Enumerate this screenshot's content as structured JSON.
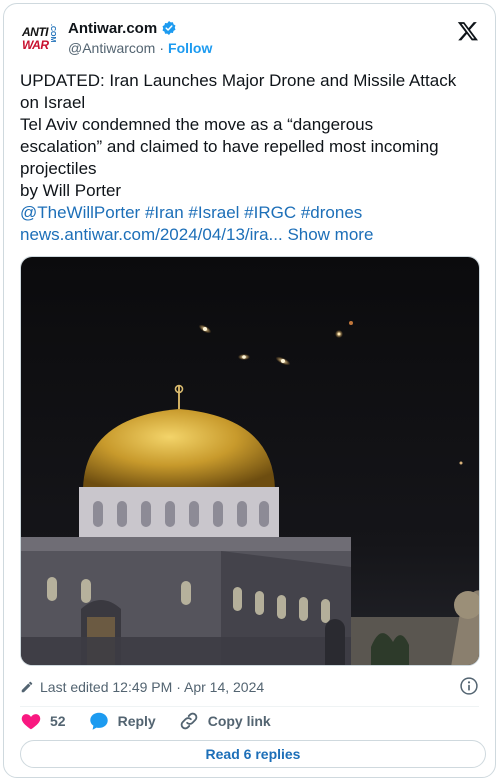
{
  "account": {
    "name": "Antiwar.com",
    "handle": "@Antiwarcom",
    "separator": "·",
    "follow_label": "Follow",
    "avatar_line1": "ANTI",
    "avatar_line2": "WAR",
    "avatar_vertical": ".COM"
  },
  "tweet": {
    "lines": [
      "UPDATED: Iran Launches Major Drone and Missile Attack",
      "on Israel",
      "Tel Aviv condemned the move as a “dangerous",
      "escalation” and claimed to have repelled most incoming",
      "projectiles",
      "by Will Porter"
    ],
    "mentions_line": "@TheWillPorter #Iran #Israel #IRGC #drones",
    "url": "news.antiwar.com/2024/04/13/ira...",
    "show_more": "Show more"
  },
  "meta": {
    "edited": "Last edited 12:49 PM · Apr 14, 2024"
  },
  "actions": {
    "likes": "52",
    "reply_label": "Reply",
    "copy_label": "Copy link"
  },
  "replies_button": "Read 6 replies",
  "colors": {
    "link": "#1d6fb8",
    "heart": "#f91880",
    "reply_icon": "#1d9bf0",
    "muted": "#536471"
  }
}
